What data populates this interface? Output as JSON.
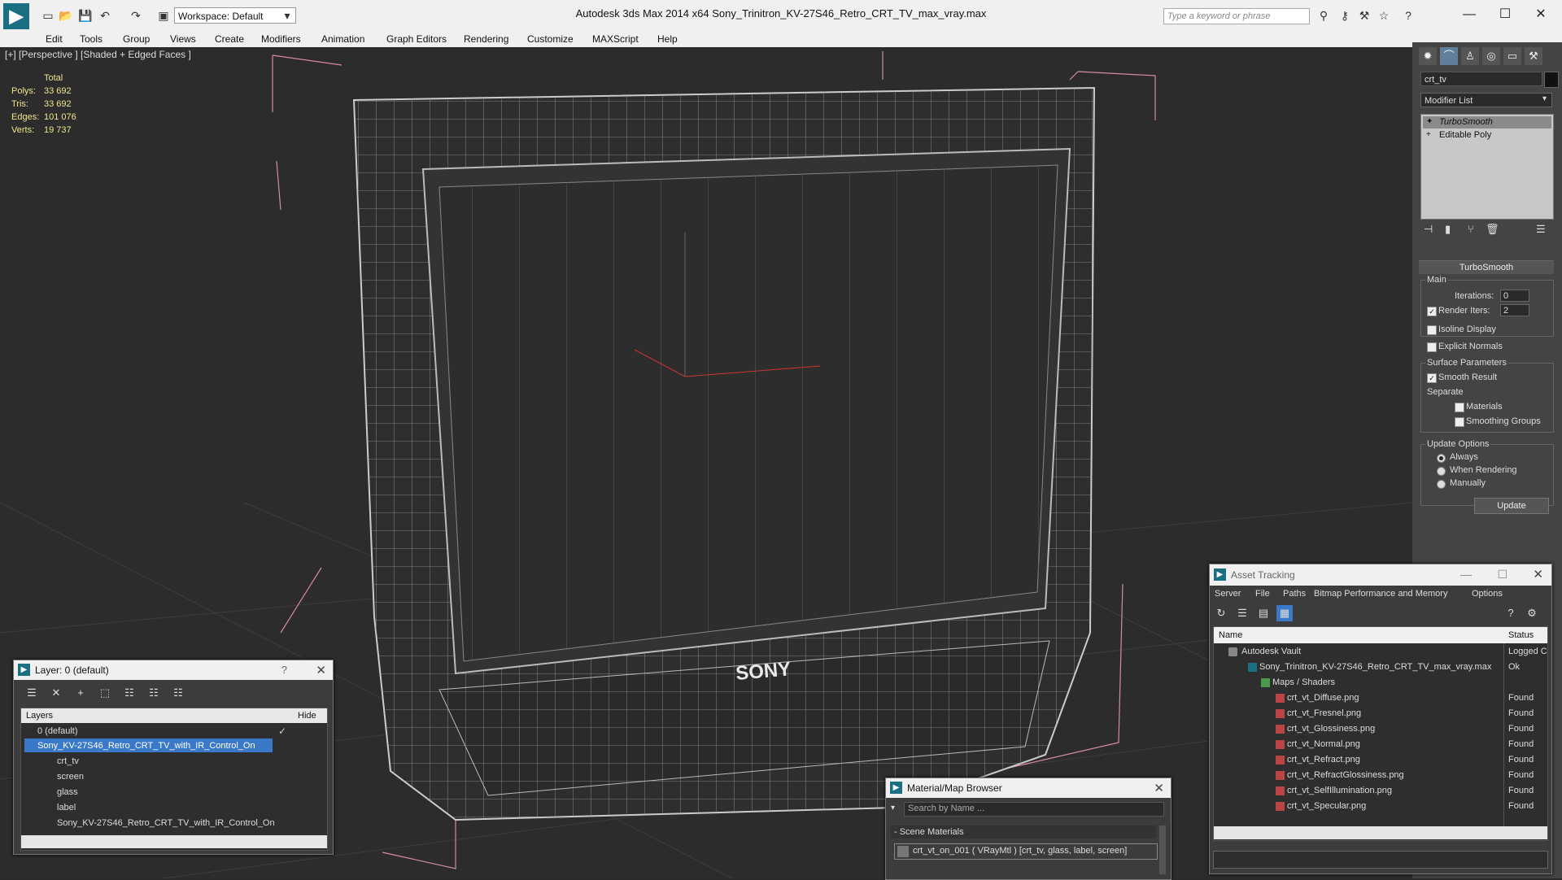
{
  "app": {
    "title": "Autodesk 3ds Max  2014 x64     Sony_Trinitron_KV-27S46_Retro_CRT_TV_max_vray.max",
    "workspace": "Workspace: Default",
    "search_placeholder": "Type a keyword or phrase"
  },
  "menu": [
    "Edit",
    "Tools",
    "Group",
    "Views",
    "Create",
    "Modifiers",
    "Animation",
    "Graph Editors",
    "Rendering",
    "Customize",
    "MAXScript",
    "Help"
  ],
  "viewport": {
    "label": "[+] [Perspective ] [Shaded + Edged Faces ]",
    "stats": {
      "header": "Total",
      "polys_label": "Polys:",
      "polys": "33 692",
      "tris_label": "Tris:",
      "tris": "33 692",
      "edges_label": "Edges:",
      "edges": "101 076",
      "verts_label": "Verts:",
      "verts": "19 737"
    },
    "tv_brand": "SONY"
  },
  "command_panel": {
    "object_name": "crt_tv",
    "modifier_list": "Modifier List",
    "stack": [
      "TurboSmooth",
      "Editable Poly"
    ],
    "rollout": "TurboSmooth",
    "main": "Main",
    "iterations_label": "Iterations:",
    "iterations": "0",
    "render_iters_label": "Render Iters:",
    "render_iters": "2",
    "isoline": "Isoline Display",
    "explicit_normals": "Explicit Normals",
    "surface_params": "Surface Parameters",
    "smooth_result": "Smooth Result",
    "separate": "Separate",
    "materials": "Materials",
    "smoothing_groups": "Smoothing Groups",
    "update_options": "Update Options",
    "always": "Always",
    "when_rendering": "When Rendering",
    "manually": "Manually",
    "update": "Update"
  },
  "layer_window": {
    "title": "Layer: 0 (default)",
    "help": "?",
    "col_layers": "Layers",
    "col_hide": "Hide",
    "rows": [
      "0 (default)",
      "Sony_KV-27S46_Retro_CRT_TV_with_IR_Control_On",
      "crt_tv",
      "screen",
      "glass",
      "label",
      "Sony_KV-27S46_Retro_CRT_TV_with_IR_Control_On"
    ]
  },
  "material_browser": {
    "title": "Material/Map Browser",
    "search_placeholder": "Search by Name ...",
    "section": "- Scene Materials",
    "material": "crt_vt_on_001  ( VRayMtl )  [crt_tv, glass, label, screen]"
  },
  "asset_tracking": {
    "title": "Asset Tracking",
    "menu": [
      "Server",
      "File",
      "Paths",
      "Bitmap Performance and Memory",
      "Options"
    ],
    "col_name": "Name",
    "col_status": "Status",
    "rows": [
      {
        "name": "Autodesk Vault",
        "status": "Logged C"
      },
      {
        "name": "Sony_Trinitron_KV-27S46_Retro_CRT_TV_max_vray.max",
        "status": "Ok"
      },
      {
        "name": "Maps / Shaders",
        "status": ""
      },
      {
        "name": "crt_vt_Diffuse.png",
        "status": "Found"
      },
      {
        "name": "crt_vt_Fresnel.png",
        "status": "Found"
      },
      {
        "name": "crt_vt_Glossiness.png",
        "status": "Found"
      },
      {
        "name": "crt_vt_Normal.png",
        "status": "Found"
      },
      {
        "name": "crt_vt_Refract.png",
        "status": "Found"
      },
      {
        "name": "crt_vt_RefractGlossiness.png",
        "status": "Found"
      },
      {
        "name": "crt_vt_SelfIllumination.png",
        "status": "Found"
      },
      {
        "name": "crt_vt_Specular.png",
        "status": "Found"
      }
    ]
  }
}
